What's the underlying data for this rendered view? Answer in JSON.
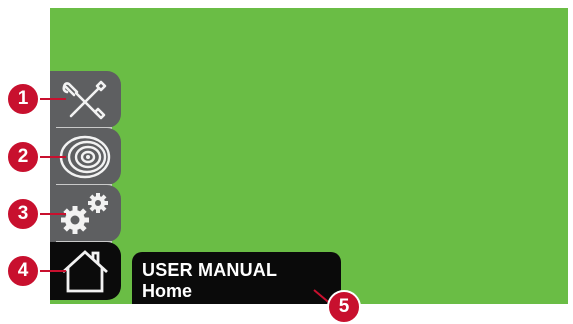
{
  "colors": {
    "screen_bg": "#6abd45",
    "tab_bg": "#5e5f61",
    "tab_active_bg": "#0b0b0b",
    "icon_stroke": "#f2f2f2",
    "divider": "#c9c9c9",
    "callout_bg": "#c8102e",
    "manual_bg": "#0a0a0a",
    "manual_text": "#ffffff"
  },
  "sidebar": {
    "items": [
      {
        "icon": "tools-icon",
        "callout": "1",
        "active": false
      },
      {
        "icon": "spool-icon",
        "callout": "2",
        "active": false
      },
      {
        "icon": "gears-icon",
        "callout": "3",
        "active": false
      },
      {
        "icon": "home-icon",
        "callout": "4",
        "active": true
      }
    ]
  },
  "manual": {
    "title": "USER MANUAL",
    "subtitle": "Home",
    "callout": "5"
  }
}
